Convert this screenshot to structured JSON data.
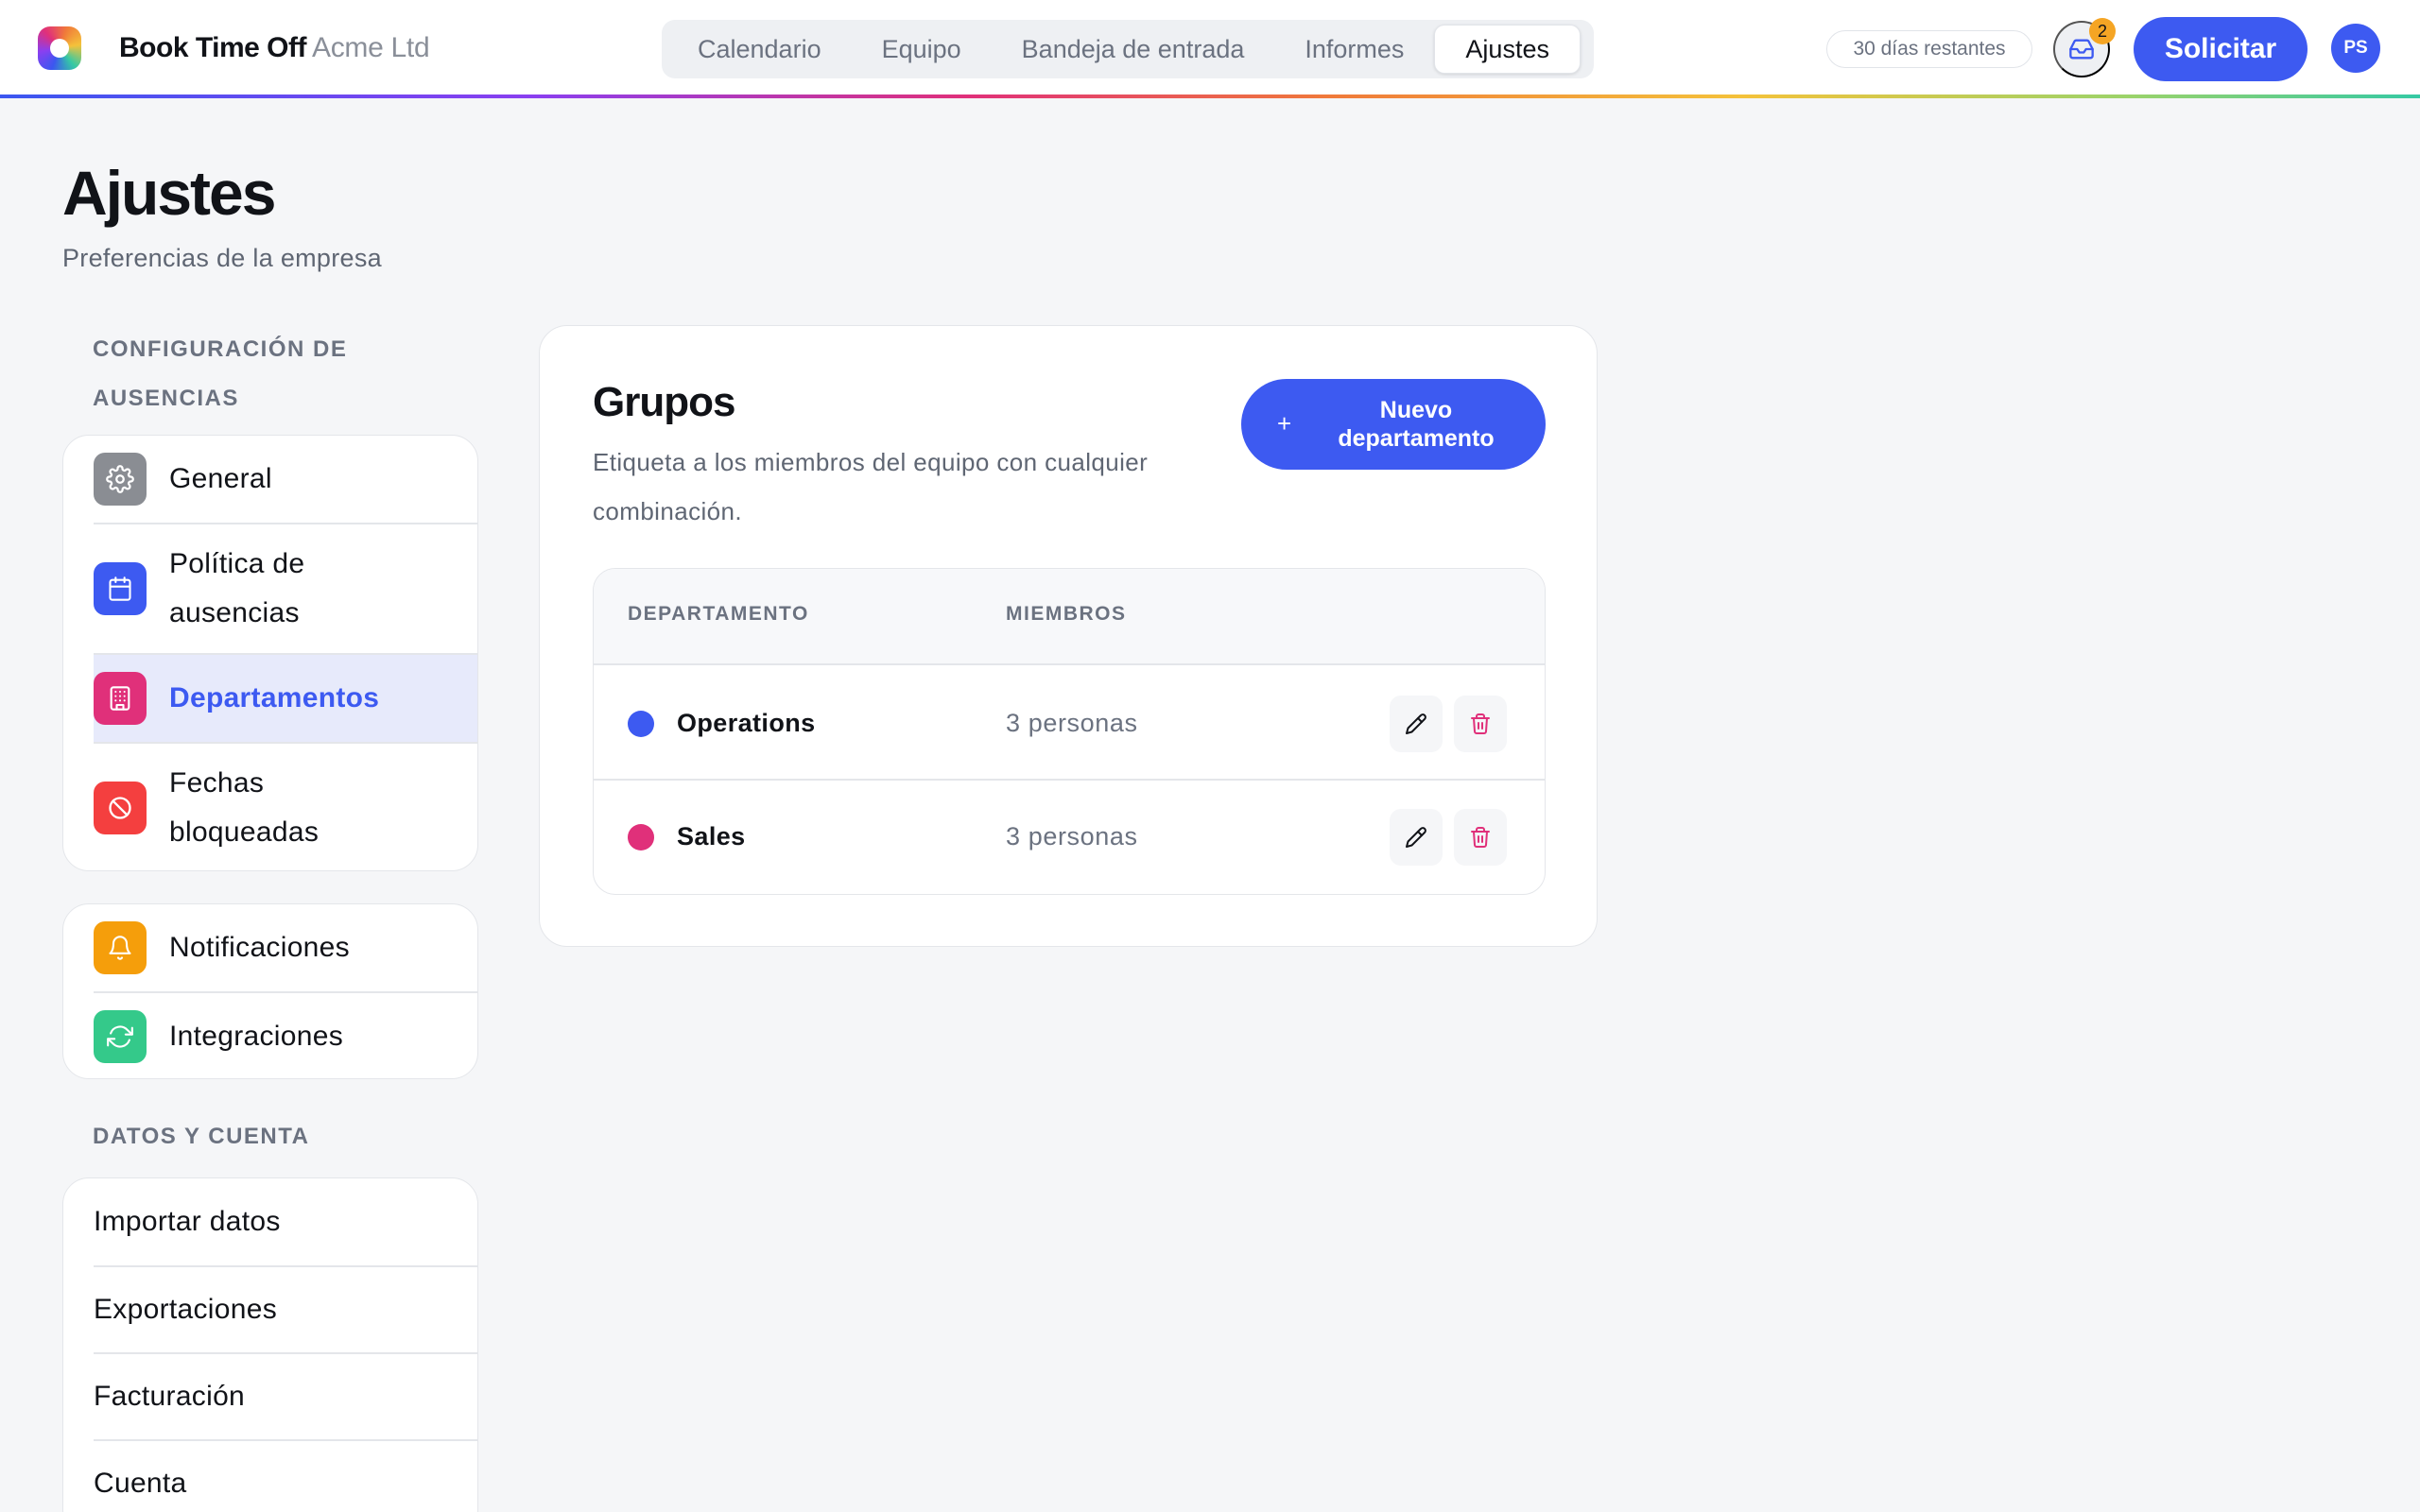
{
  "app": {
    "brand": "Book Time Off",
    "company": "Acme Ltd"
  },
  "nav": {
    "tabs": [
      {
        "label": "Calendario",
        "active": false
      },
      {
        "label": "Equipo",
        "active": false
      },
      {
        "label": "Bandeja de entrada",
        "active": false
      },
      {
        "label": "Informes",
        "active": false
      },
      {
        "label": "Ajustes",
        "active": true
      }
    ]
  },
  "header": {
    "days_remaining": "30 días restantes",
    "inbox_count": "2",
    "request_label": "Solicitar",
    "avatar_initials": "PS"
  },
  "page": {
    "title": "Ajustes",
    "subtitle": "Preferencias de la empresa"
  },
  "sidebar": {
    "section1_label": "CONFIGURACIÓN DE AUSENCIAS",
    "group1": [
      {
        "label": "General",
        "icon": "gear-icon",
        "color": "#8a8d93"
      },
      {
        "label": "Política de ausencias",
        "icon": "calendar-icon",
        "color": "#3d5af1"
      },
      {
        "label": "Departamentos",
        "icon": "building-icon",
        "color": "#e0307a",
        "selected": true
      },
      {
        "label": "Fechas bloqueadas",
        "icon": "block-icon",
        "color": "#f43f3f"
      }
    ],
    "group2": [
      {
        "label": "Notificaciones",
        "icon": "bell-icon",
        "color": "#f59e0b"
      },
      {
        "label": "Integraciones",
        "icon": "sync-icon",
        "color": "#34c98a"
      }
    ],
    "section2_label": "DATOS Y CUENTA",
    "group3": [
      {
        "label": "Importar datos"
      },
      {
        "label": "Exportaciones"
      },
      {
        "label": "Facturación"
      },
      {
        "label": "Cuenta"
      }
    ]
  },
  "main": {
    "title": "Grupos",
    "description": "Etiqueta a los miembros del equipo con cualquier combinación.",
    "new_button": "Nuevo departamento",
    "columns": [
      "DEPARTAMENTO",
      "MIEMBROS"
    ],
    "rows": [
      {
        "name": "Operations",
        "members": "3 personas",
        "color": "#3d5af1"
      },
      {
        "name": "Sales",
        "members": "3 personas",
        "color": "#e0307a"
      }
    ]
  },
  "colors": {
    "accent": "#3d5af1",
    "badge": "#f5a524",
    "danger": "#e0307a"
  }
}
